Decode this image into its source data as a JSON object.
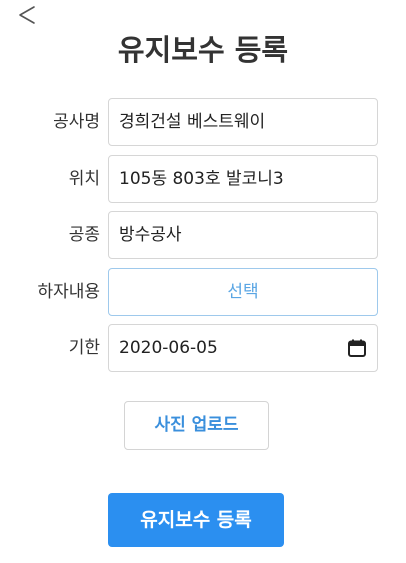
{
  "header": {
    "back_icon": "chevron-left-icon",
    "title": "유지보수 등록"
  },
  "form": {
    "company": {
      "label": "공사명",
      "value": "경희건설 베스트웨이"
    },
    "location": {
      "label": "위치",
      "value": "105동 803호 발코니3"
    },
    "work_type": {
      "label": "공종",
      "value": "방수공사"
    },
    "defect": {
      "label": "하자내용",
      "value": "선택"
    },
    "deadline": {
      "label": "기한",
      "value": "2020-06-05",
      "icon": "calendar-icon"
    }
  },
  "actions": {
    "upload_label": "사진 업로드",
    "submit_label": "유지보수 등록"
  },
  "colors": {
    "primary": "#2b8ff0",
    "link_text": "#3a8fdc",
    "select_placeholder": "#5aa6e4",
    "border": "#d6d6d6"
  }
}
